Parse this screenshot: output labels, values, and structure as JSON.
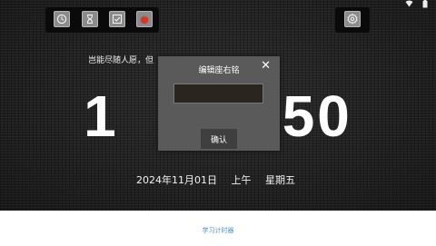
{
  "status_bar": {
    "icons": [
      "wifi-icon",
      "battery-icon"
    ]
  },
  "toolbar": {
    "left_buttons": [
      {
        "name": "clock-icon"
      },
      {
        "name": "hourglass-icon"
      },
      {
        "name": "checklist-icon"
      },
      {
        "name": "tomato-icon"
      }
    ],
    "right_button": {
      "name": "gear-icon"
    }
  },
  "motto": {
    "text": "岂能尽随人愿，但"
  },
  "clock": {
    "left": "1",
    "hidden_middle": "",
    "right": "50"
  },
  "date": {
    "date": "2024年11月01日",
    "period": "上午",
    "weekday": "星期五"
  },
  "dialog": {
    "title": "编辑座右铭",
    "close_symbol": "✕",
    "input_value": "",
    "confirm_label": "确认"
  },
  "bottom": {
    "label": "学习计时器"
  },
  "colors": {
    "tomato": "#d9342b",
    "link_blue": "#4a90d9",
    "dialog_bg": "#5c5c5c"
  }
}
